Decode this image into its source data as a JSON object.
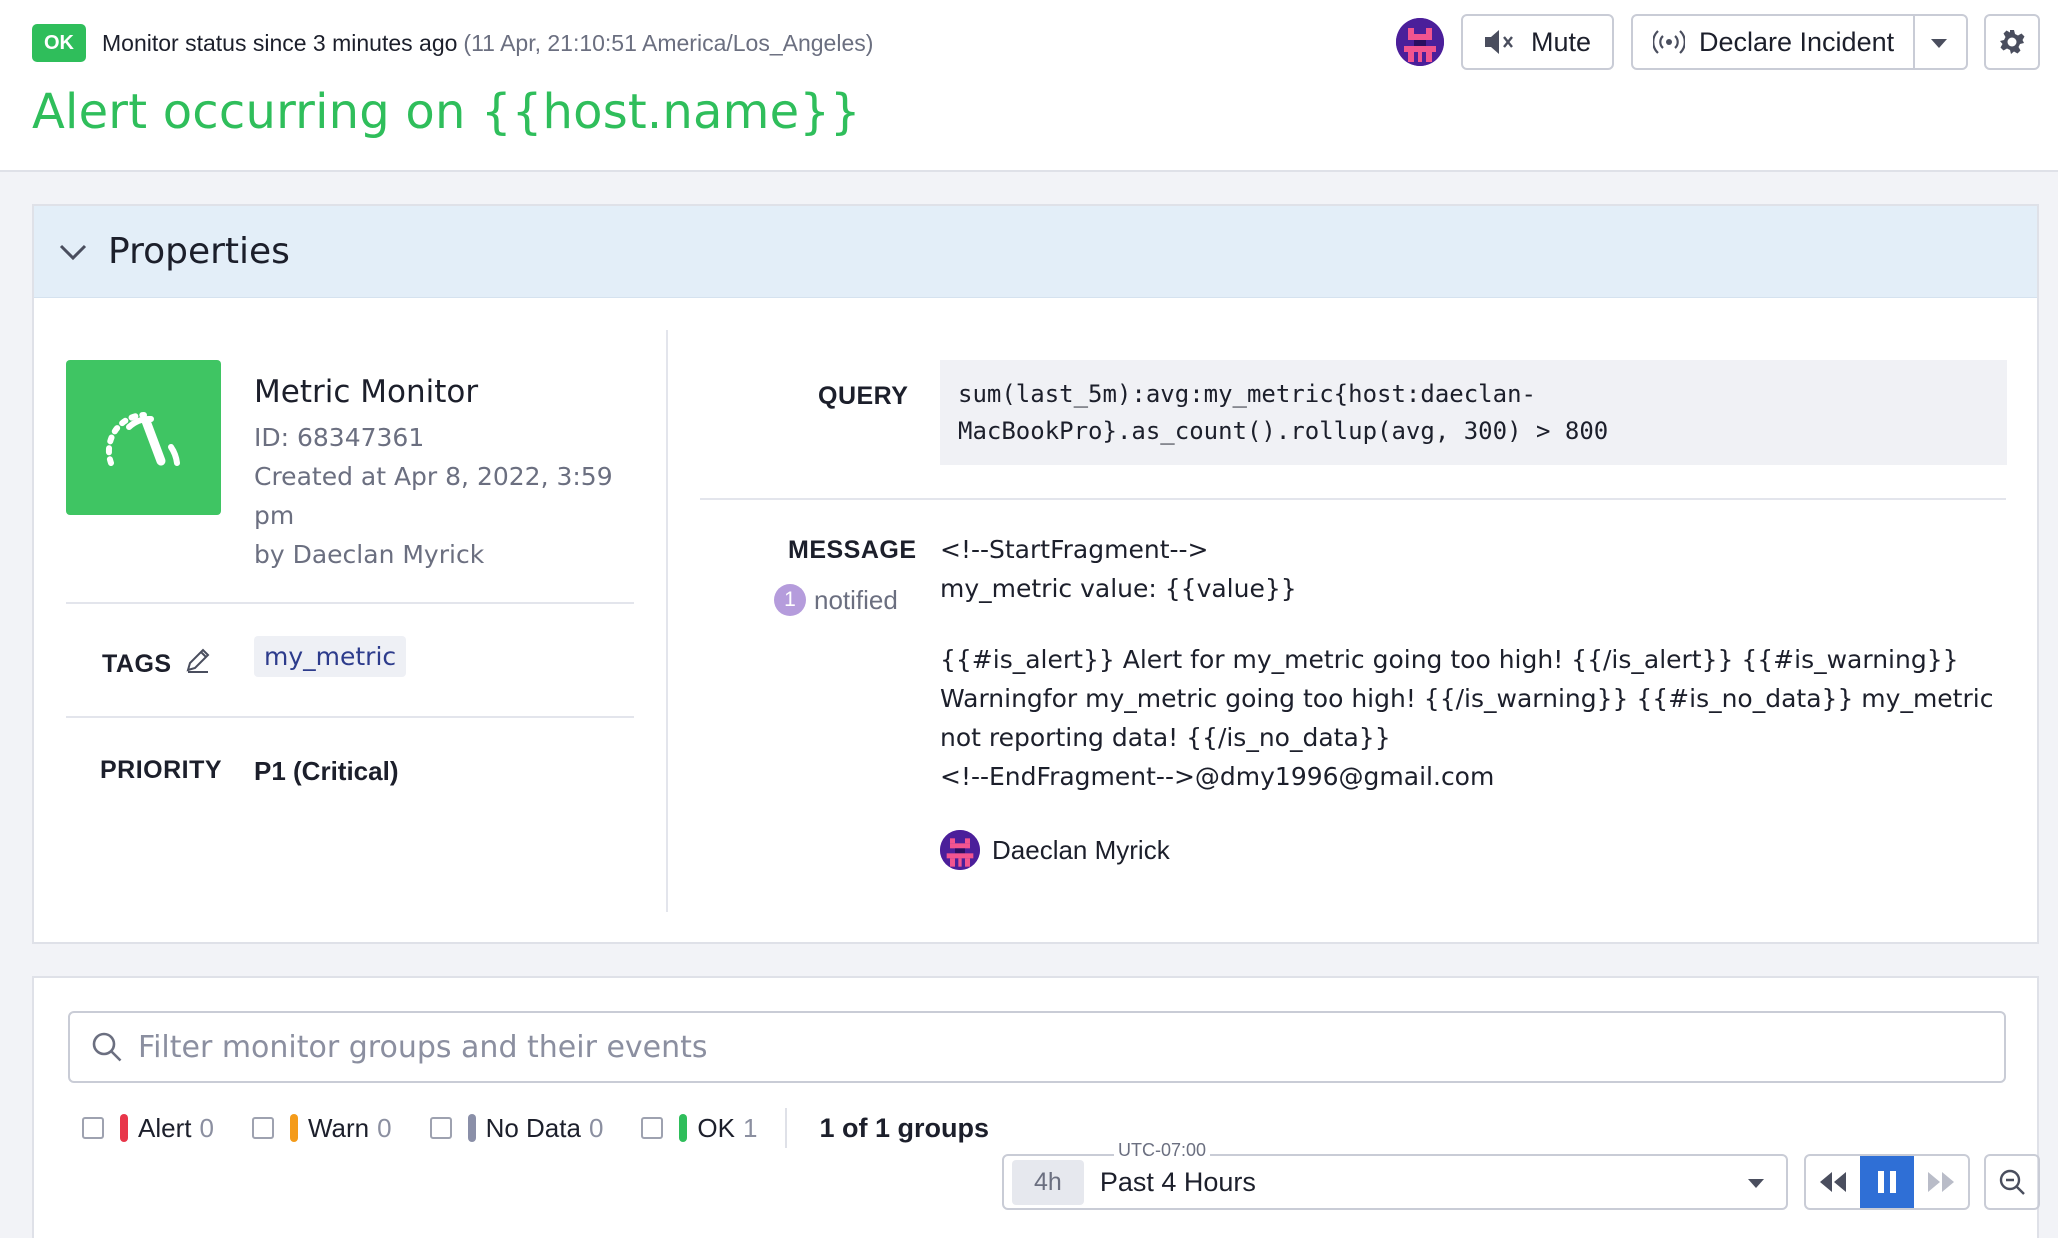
{
  "header": {
    "status_badge": "OK",
    "status_text": "Monitor status since 3 minutes ago",
    "status_time": "(11 Apr, 21:10:51 America/Los_Angeles)",
    "title": "Alert occurring on {{host.name}}",
    "mute_label": "Mute",
    "declare_incident_label": "Declare Incident"
  },
  "properties": {
    "section_title": "Properties",
    "monitor": {
      "type": "Metric Monitor",
      "id": "ID: 68347361",
      "created": "Created at Apr 8, 2022, 3:59 pm",
      "author": "by Daeclan Myrick"
    },
    "tags_label": "TAGS",
    "tags": [
      "my_metric"
    ],
    "priority_label": "PRIORITY",
    "priority_value": "P1 (Critical)",
    "query_label": "QUERY",
    "query": "sum(last_5m):avg:my_metric{host:daeclan-\nMacBookPro}.as_count().rollup(avg, 300) > 800",
    "message_label": "MESSAGE",
    "notified_count": "1",
    "notified_label": "notified",
    "message_lines": [
      "<!--StartFragment-->",
      "my_metric value: {{value}}"
    ],
    "message_paragraph": "{{#is_alert}} Alert for my_metric going too high! {{/is_alert}} {{#is_warning}} Warningfor my_metric going too high! {{/is_warning}} {{#is_no_data}} my_metric not reporting data! {{/is_no_data}}",
    "message_end": "<!--EndFragment-->@dmy1996@gmail.com",
    "recipient": "Daeclan Myrick"
  },
  "groups": {
    "search_placeholder": "Filter monitor groups and their events",
    "filters": [
      {
        "label": "Alert",
        "count": "0",
        "color": "#e8364a"
      },
      {
        "label": "Warn",
        "count": "0",
        "color": "#f49b1a"
      },
      {
        "label": "No Data",
        "count": "0",
        "color": "#8a8fa8"
      },
      {
        "label": "OK",
        "count": "1",
        "color": "#2fbe5b"
      }
    ],
    "groups_count": "1 of 1 groups",
    "timezone": "UTC-07:00",
    "time_chip": "4h",
    "time_label": "Past 4 Hours"
  },
  "icons": {
    "mute": "speaker-mute-icon",
    "incident": "broadcast-icon",
    "settings": "gear-icon",
    "collapse": "chevron-down-icon",
    "monitor": "speedometer-icon",
    "edit": "pencil-icon",
    "search": "search-icon",
    "zoom": "zoom-out-icon"
  },
  "colors": {
    "ok_green": "#2fbe5b",
    "accent_blue": "#2f6fd6",
    "properties_header_bg": "#e3eef8"
  }
}
